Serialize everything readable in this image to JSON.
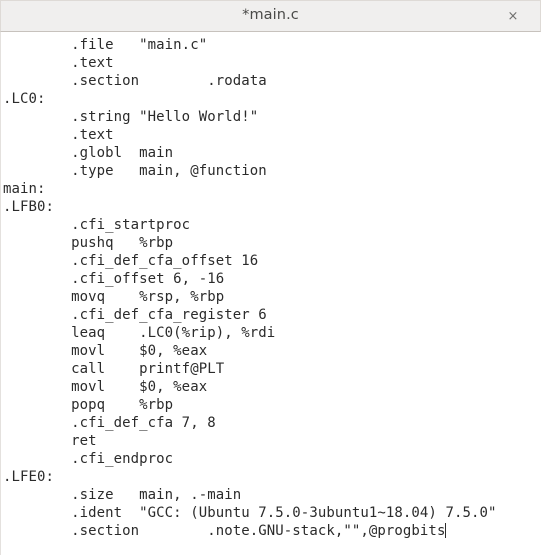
{
  "window": {
    "title": "*main.c",
    "close_icon": "close-icon",
    "close_label": "×"
  },
  "editor": {
    "filename": "main.c",
    "modified": true,
    "caret_after_text": "@progbits",
    "lines": [
      "        .file   \"main.c\"",
      "        .text",
      "        .section        .rodata",
      ".LC0:",
      "        .string \"Hello World!\"",
      "        .text",
      "        .globl  main",
      "        .type   main, @function",
      "main:",
      ".LFB0:",
      "        .cfi_startproc",
      "        pushq   %rbp",
      "        .cfi_def_cfa_offset 16",
      "        .cfi_offset 6, -16",
      "        movq    %rsp, %rbp",
      "        .cfi_def_cfa_register 6",
      "        leaq    .LC0(%rip), %rdi",
      "        movl    $0, %eax",
      "        call    printf@PLT",
      "        movl    $0, %eax",
      "        popq    %rbp",
      "        .cfi_def_cfa 7, 8",
      "        ret",
      "        .cfi_endproc",
      ".LFE0:",
      "        .size   main, .-main",
      "        .ident  \"GCC: (Ubuntu 7.5.0-3ubuntu1~18.04) 7.5.0\"",
      "        .section        .note.GNU-stack,\"\",@progbits"
    ],
    "last_line_index": 27
  },
  "colors": {
    "titlebar_background": "#f0efee",
    "titlebar_text": "#4a4a48",
    "code_background": "#ffffff",
    "code_text": "#2b2b2b",
    "border": "#dedad6"
  }
}
